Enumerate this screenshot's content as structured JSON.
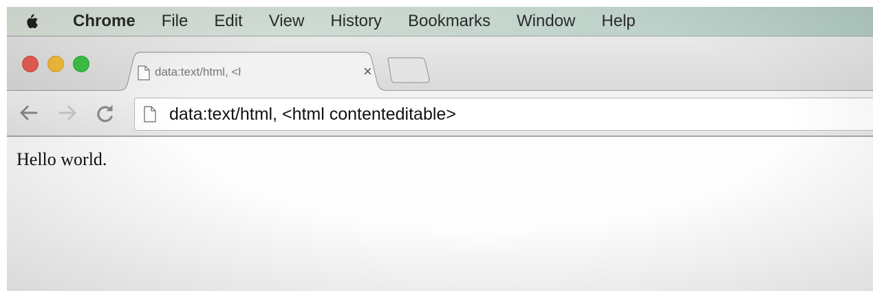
{
  "menubar": {
    "apple_icon": "apple-logo-icon",
    "items": [
      "Chrome",
      "File",
      "Edit",
      "View",
      "History",
      "Bookmarks",
      "Window",
      "Help"
    ]
  },
  "window": {
    "traffic_lights": {
      "close": "#ec5f55",
      "minimize": "#f5bd38",
      "zoom": "#3ec247"
    }
  },
  "tabs": [
    {
      "title": "data:text/html, <html contenteditable>",
      "icon": "page-icon",
      "close": "×"
    }
  ],
  "toolbar": {
    "back_icon": "arrow-left-icon",
    "forward_icon": "arrow-right-icon",
    "reload_icon": "reload-icon",
    "address": "data:text/html, <html contenteditable>"
  },
  "page": {
    "text": "Hello world."
  }
}
